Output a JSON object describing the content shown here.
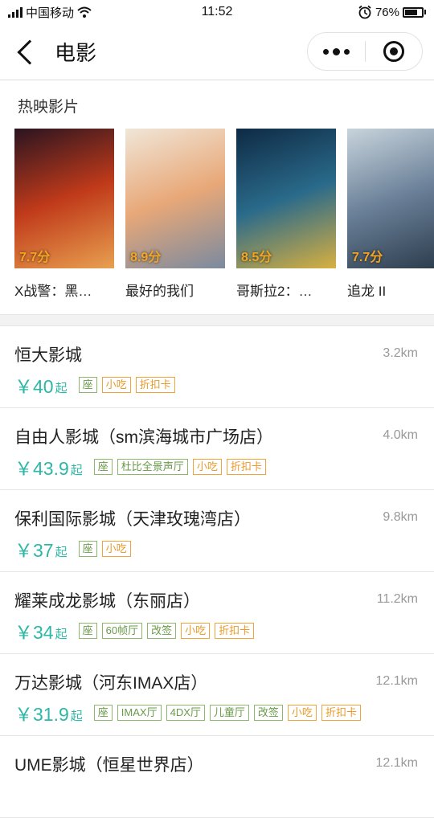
{
  "status_bar": {
    "carrier": "中国移动",
    "time": "11:52",
    "battery_percent": "76%",
    "battery_level": 0.76
  },
  "nav": {
    "title": "电影"
  },
  "hot_section": {
    "title": "热映影片",
    "movies": [
      {
        "name": "X战警：黑…",
        "rating": "7.7分",
        "colors": [
          "#2a1420",
          "#c03a1a",
          "#e8a050"
        ]
      },
      {
        "name": "最好的我们",
        "rating": "8.9分",
        "colors": [
          "#f0e6d8",
          "#e8a878",
          "#7a8aa0"
        ]
      },
      {
        "name": "哥斯拉2：…",
        "rating": "8.5分",
        "colors": [
          "#0e2a44",
          "#2a6a8a",
          "#d8b040"
        ]
      },
      {
        "name": "追龙 II",
        "rating": "7.7分",
        "colors": [
          "#c8d4dc",
          "#6a8098",
          "#2a3a4a"
        ]
      }
    ]
  },
  "cinemas": [
    {
      "name": "恒大影城",
      "distance": "3.2km",
      "price": "￥40",
      "suffix": "起",
      "tags": [
        {
          "text": "座",
          "color": "green"
        },
        {
          "text": "小吃",
          "color": "orange"
        },
        {
          "text": "折扣卡",
          "color": "orange"
        }
      ]
    },
    {
      "name": "自由人影城（sm滨海城市广场店）",
      "distance": "4.0km",
      "price": "￥43.9",
      "suffix": "起",
      "tags": [
        {
          "text": "座",
          "color": "green"
        },
        {
          "text": "杜比全景声厅",
          "color": "green"
        },
        {
          "text": "小吃",
          "color": "orange"
        },
        {
          "text": "折扣卡",
          "color": "orange"
        }
      ]
    },
    {
      "name": "保利国际影城（天津玫瑰湾店）",
      "distance": "9.8km",
      "price": "￥37",
      "suffix": "起",
      "tags": [
        {
          "text": "座",
          "color": "green"
        },
        {
          "text": "小吃",
          "color": "orange"
        }
      ]
    },
    {
      "name": "耀莱成龙影城（东丽店）",
      "distance": "11.2km",
      "price": "￥34",
      "suffix": "起",
      "tags": [
        {
          "text": "座",
          "color": "green"
        },
        {
          "text": "60帧厅",
          "color": "green"
        },
        {
          "text": "改签",
          "color": "green"
        },
        {
          "text": "小吃",
          "color": "orange"
        },
        {
          "text": "折扣卡",
          "color": "orange"
        }
      ]
    },
    {
      "name": "万达影城（河东IMAX店）",
      "distance": "12.1km",
      "price": "￥31.9",
      "suffix": "起",
      "tags": [
        {
          "text": "座",
          "color": "green"
        },
        {
          "text": "IMAX厅",
          "color": "green"
        },
        {
          "text": "4DX厅",
          "color": "green"
        },
        {
          "text": "儿童厅",
          "color": "green"
        },
        {
          "text": "改签",
          "color": "green"
        },
        {
          "text": "小吃",
          "color": "orange"
        },
        {
          "text": "折扣卡",
          "color": "orange"
        }
      ]
    },
    {
      "name": "UME影城（恒星世界店）",
      "distance": "12.1km",
      "price": "",
      "suffix": "",
      "tags": []
    }
  ],
  "colors": {
    "accent": "#2db7a5",
    "rating": "#f4a623",
    "tag_green": "#6a9a4a",
    "tag_orange": "#e89a2a"
  }
}
